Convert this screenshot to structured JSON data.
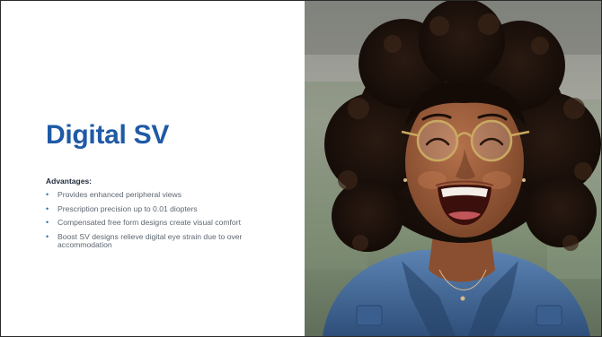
{
  "slide": {
    "title": "Digital SV",
    "subheading": "Advantages:",
    "bullets": [
      "Provides enhanced peripheral views",
      "Prescription precision up to 0.01 diopters",
      "Compensated free form designs create visual comfort",
      "Boost SV designs relieve digital eye strain due to over accommodation"
    ],
    "bullet_glyph": "•"
  },
  "photo": {
    "subject": "laughing woman with curly hair wearing round glasses and denim jacket"
  },
  "colors": {
    "title": "#1f5aa6",
    "bullet_marker": "#2e6cc4",
    "body_text": "#5d6670"
  }
}
